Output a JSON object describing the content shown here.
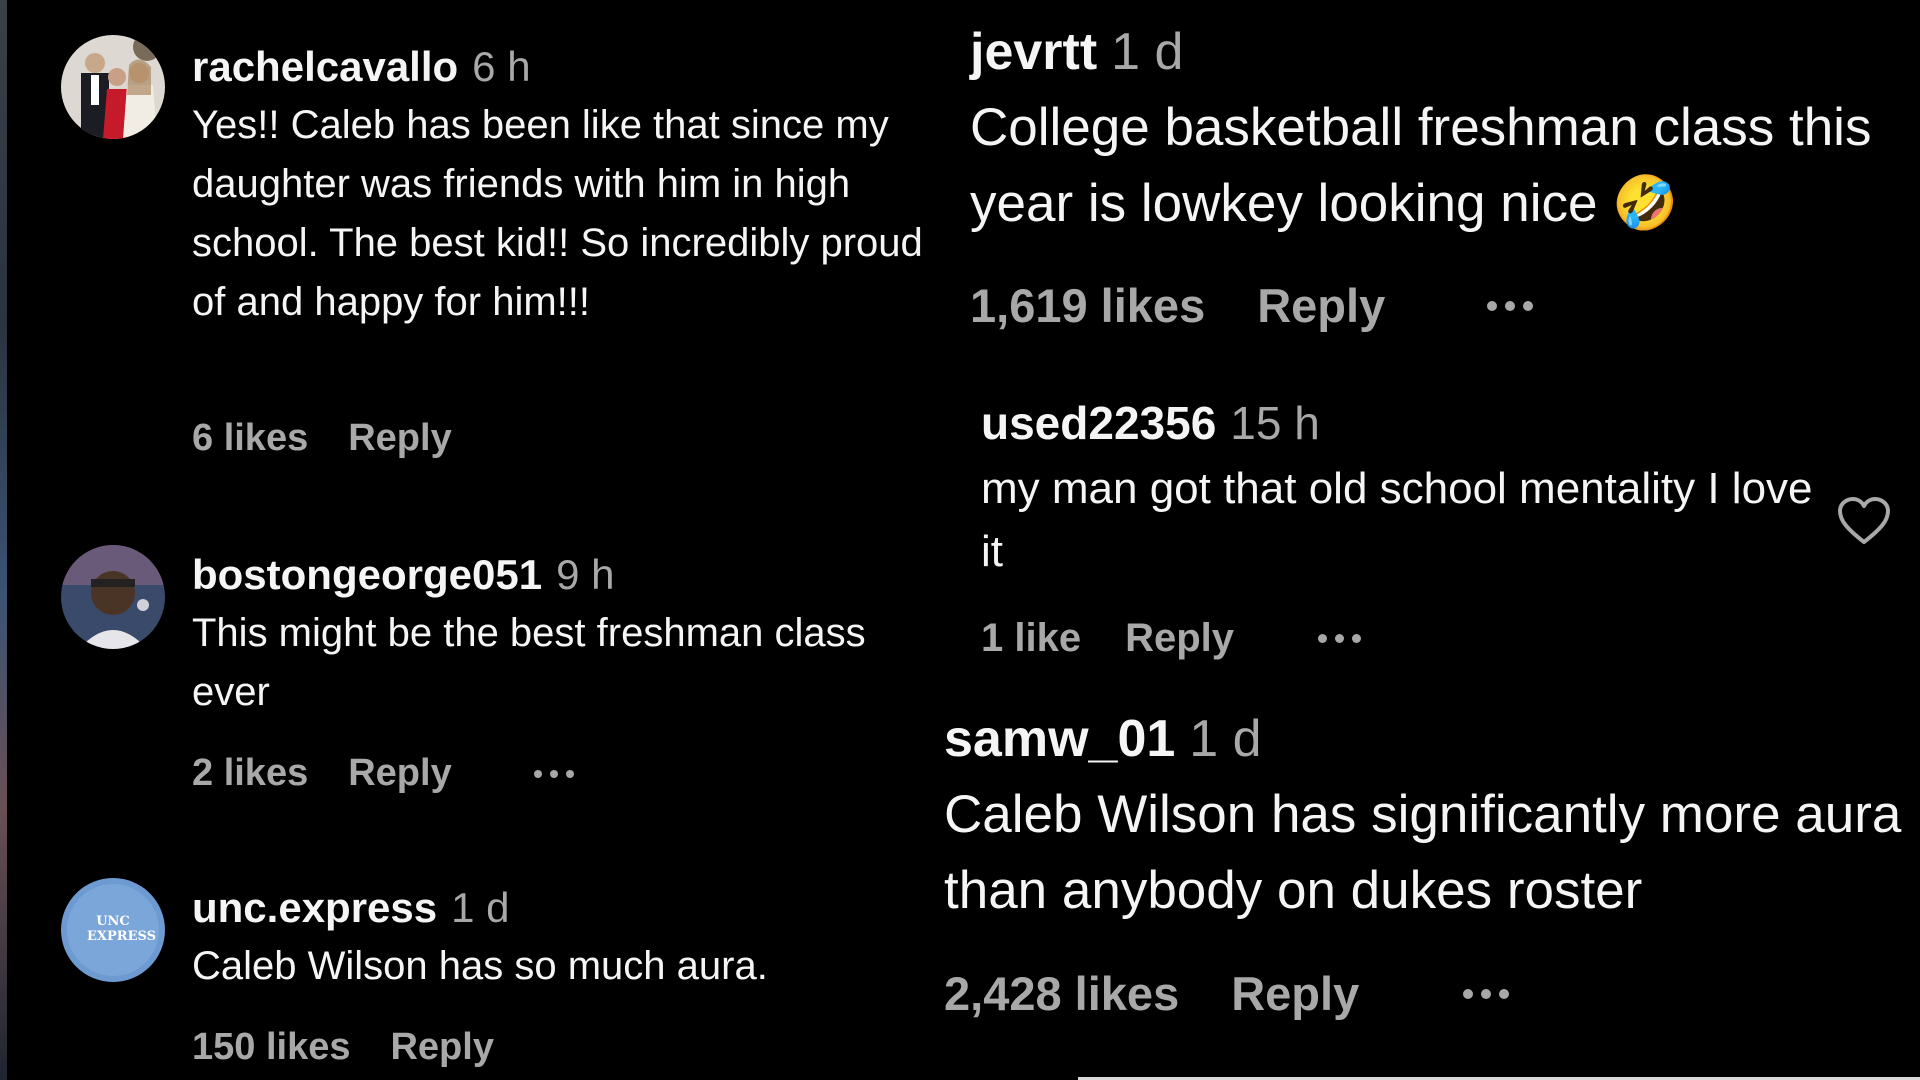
{
  "comments_left": [
    {
      "username": "rachelcavallo",
      "time": "6 h",
      "text": "Yes!! Caleb has been like that since my daughter was friends with him in high school. The best kid!! So incredibly proud of and happy for him!!!",
      "likes": "6 likes",
      "reply": "Reply",
      "avatar_icon": "family-photo-avatar"
    },
    {
      "username": "bostongeorge051",
      "time": "9 h",
      "text": "This might be the best freshman class ever",
      "likes": "2 likes",
      "reply": "Reply",
      "avatar_icon": "person-photo-avatar"
    },
    {
      "username": "unc.express",
      "time": "1 d",
      "text": "Caleb Wilson has so much aura.",
      "likes": "150 likes",
      "reply": "Reply",
      "avatar_icon": "unc-express-logo-avatar",
      "avatar_text": "UNC EXPRESS"
    }
  ],
  "comments_right": [
    {
      "username": "jevrtt",
      "time": "1 d",
      "text": "College basketball freshman class this year is lowkey looking nice 🤣",
      "likes": "1,619 likes",
      "reply": "Reply"
    },
    {
      "username": "used22356",
      "time": "15 h",
      "text": "my man got that old school mentality I love it",
      "likes": "1 like",
      "reply": "Reply",
      "heart_icon": "heart-outline-icon"
    },
    {
      "username": "samw_01",
      "time": "1 d",
      "text": "Caleb Wilson has significantly more aura than anybody on dukes roster",
      "likes": "2,428 likes",
      "reply": "Reply"
    }
  ],
  "colors": {
    "background": "#000000",
    "text": "#f5f5f5",
    "secondary": "#a8a8a8"
  }
}
